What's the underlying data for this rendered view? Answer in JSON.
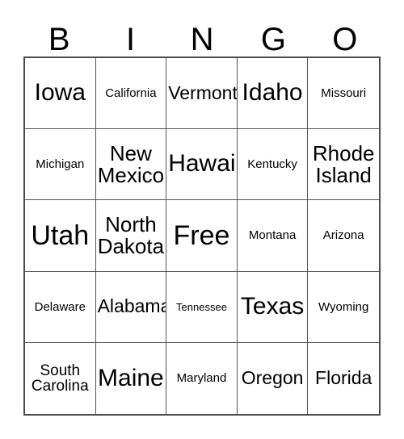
{
  "header": {
    "letters": [
      "B",
      "I",
      "N",
      "G",
      "O"
    ]
  },
  "grid": {
    "columns": 5,
    "rows": 5,
    "free_space_label": "Free",
    "border_color": "#4d4d4d",
    "background_color": "#ffffff",
    "text_color": "#000000",
    "cells": [
      {
        "label": "Iowa",
        "size": "lg"
      },
      {
        "label": "California",
        "size": "xs"
      },
      {
        "label": "Vermont",
        "size": "md"
      },
      {
        "label": "Idaho",
        "size": "lg"
      },
      {
        "label": "Missouri",
        "size": "xs"
      },
      {
        "label": "Michigan",
        "size": "xs"
      },
      {
        "label": "New\nMexico",
        "size": "ml"
      },
      {
        "label": "Hawaii",
        "size": "lg"
      },
      {
        "label": "Kentucky",
        "size": "xs"
      },
      {
        "label": "Rhode\nIsland",
        "size": "ml"
      },
      {
        "label": "Utah",
        "size": "xl"
      },
      {
        "label": "North\nDakota",
        "size": "ml"
      },
      {
        "label": "Free",
        "size": "xl"
      },
      {
        "label": "Montana",
        "size": "xs"
      },
      {
        "label": "Arizona",
        "size": "xs"
      },
      {
        "label": "Delaware",
        "size": "xs"
      },
      {
        "label": "Alabama",
        "size": "md"
      },
      {
        "label": "Tennessee",
        "size": "xxs"
      },
      {
        "label": "Texas",
        "size": "lg"
      },
      {
        "label": "Wyoming",
        "size": "xs"
      },
      {
        "label": "South\nCarolina",
        "size": "sm"
      },
      {
        "label": "Maine",
        "size": "lg"
      },
      {
        "label": "Maryland",
        "size": "xs"
      },
      {
        "label": "Oregon",
        "size": "md"
      },
      {
        "label": "Florida",
        "size": "md"
      }
    ]
  }
}
